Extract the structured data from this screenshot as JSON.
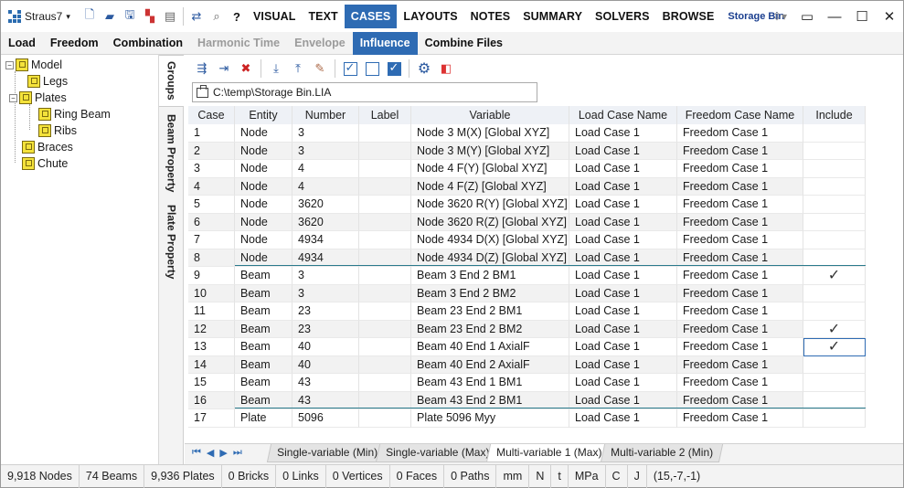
{
  "app": {
    "name": "Straus7"
  },
  "menu": {
    "items": [
      "VISUAL",
      "TEXT",
      "CASES",
      "LAYOUTS",
      "NOTES",
      "SUMMARY",
      "SOLVERS",
      "BROWSE"
    ],
    "active": "CASES",
    "model_name": "Storage Bin"
  },
  "subtabs": {
    "items": [
      {
        "label": "Load",
        "state": "normal"
      },
      {
        "label": "Freedom",
        "state": "normal"
      },
      {
        "label": "Combination",
        "state": "normal"
      },
      {
        "label": "Harmonic Time",
        "state": "disabled"
      },
      {
        "label": "Envelope",
        "state": "disabled"
      },
      {
        "label": "Influence",
        "state": "active"
      },
      {
        "label": "Combine Files",
        "state": "normal"
      }
    ]
  },
  "tree": {
    "root": "Model",
    "legs": "Legs",
    "plates": "Plates",
    "ring_beam": "Ring Beam",
    "ribs": "Ribs",
    "braces": "Braces",
    "chute": "Chute"
  },
  "side_tabs": [
    "Groups",
    "Beam Property",
    "Plate Property"
  ],
  "file_path": "C:\\temp\\Storage Bin.LIA",
  "table": {
    "headers": [
      "Case",
      "Entity",
      "Number",
      "Label",
      "Variable",
      "Load Case Name",
      "Freedom Case Name",
      "Include"
    ],
    "rows": [
      {
        "case": "1",
        "entity": "Node",
        "number": "3",
        "label": "",
        "variable": "Node 3 M(X) [Global XYZ]",
        "load": "Load Case 1",
        "freedom": "Freedom Case 1",
        "include": ""
      },
      {
        "case": "2",
        "entity": "Node",
        "number": "3",
        "label": "",
        "variable": "Node 3 M(Y) [Global XYZ]",
        "load": "Load Case 1",
        "freedom": "Freedom Case 1",
        "include": ""
      },
      {
        "case": "3",
        "entity": "Node",
        "number": "4",
        "label": "",
        "variable": "Node 4 F(Y) [Global XYZ]",
        "load": "Load Case 1",
        "freedom": "Freedom Case 1",
        "include": ""
      },
      {
        "case": "4",
        "entity": "Node",
        "number": "4",
        "label": "",
        "variable": "Node 4 F(Z) [Global XYZ]",
        "load": "Load Case 1",
        "freedom": "Freedom Case 1",
        "include": ""
      },
      {
        "case": "5",
        "entity": "Node",
        "number": "3620",
        "label": "",
        "variable": "Node 3620 R(Y) [Global XYZ]",
        "load": "Load Case 1",
        "freedom": "Freedom Case 1",
        "include": ""
      },
      {
        "case": "6",
        "entity": "Node",
        "number": "3620",
        "label": "",
        "variable": "Node 3620 R(Z) [Global XYZ]",
        "load": "Load Case 1",
        "freedom": "Freedom Case 1",
        "include": ""
      },
      {
        "case": "7",
        "entity": "Node",
        "number": "4934",
        "label": "",
        "variable": "Node 4934 D(X) [Global XYZ]",
        "load": "Load Case 1",
        "freedom": "Freedom Case 1",
        "include": ""
      },
      {
        "case": "8",
        "entity": "Node",
        "number": "4934",
        "label": "",
        "variable": "Node 4934 D(Z) [Global XYZ]",
        "load": "Load Case 1",
        "freedom": "Freedom Case 1",
        "include": ""
      },
      {
        "case": "9",
        "entity": "Beam",
        "number": "3",
        "label": "",
        "variable": "Beam 3 End 2 BM1",
        "load": "Load Case 1",
        "freedom": "Freedom Case 1",
        "include": "✓"
      },
      {
        "case": "10",
        "entity": "Beam",
        "number": "3",
        "label": "",
        "variable": "Beam 3 End 2 BM2",
        "load": "Load Case 1",
        "freedom": "Freedom Case 1",
        "include": ""
      },
      {
        "case": "11",
        "entity": "Beam",
        "number": "23",
        "label": "",
        "variable": "Beam 23 End 2 BM1",
        "load": "Load Case 1",
        "freedom": "Freedom Case 1",
        "include": ""
      },
      {
        "case": "12",
        "entity": "Beam",
        "number": "23",
        "label": "",
        "variable": "Beam 23 End 2 BM2",
        "load": "Load Case 1",
        "freedom": "Freedom Case 1",
        "include": "✓"
      },
      {
        "case": "13",
        "entity": "Beam",
        "number": "40",
        "label": "",
        "variable": "Beam 40 End 1 AxialF",
        "load": "Load Case 1",
        "freedom": "Freedom Case 1",
        "include": "✓"
      },
      {
        "case": "14",
        "entity": "Beam",
        "number": "40",
        "label": "",
        "variable": "Beam 40 End 2 AxialF",
        "load": "Load Case 1",
        "freedom": "Freedom Case 1",
        "include": ""
      },
      {
        "case": "15",
        "entity": "Beam",
        "number": "43",
        "label": "",
        "variable": "Beam 43 End 1 BM1",
        "load": "Load Case 1",
        "freedom": "Freedom Case 1",
        "include": ""
      },
      {
        "case": "16",
        "entity": "Beam",
        "number": "43",
        "label": "",
        "variable": "Beam 43 End 2 BM1",
        "load": "Load Case 1",
        "freedom": "Freedom Case 1",
        "include": ""
      },
      {
        "case": "17",
        "entity": "Plate",
        "number": "5096",
        "label": "",
        "variable": "Plate 5096 Myy",
        "load": "Load Case 1",
        "freedom": "Freedom Case 1",
        "include": ""
      }
    ]
  },
  "sheets": [
    "Single-variable (Min)",
    "Single-variable (Max)",
    "Multi-variable 1 (Max)",
    "Multi-variable 2 (Min)"
  ],
  "active_sheet": "Multi-variable 1 (Max)",
  "status": [
    "9,918 Nodes",
    "74 Beams",
    "9,936 Plates",
    "0 Bricks",
    "0 Links",
    "0 Vertices",
    "0 Faces",
    "0 Paths",
    "mm",
    "N",
    "t",
    "MPa",
    "C",
    "J",
    "(15,-7,-1)"
  ],
  "colors": {
    "accent": "#2e6bb3",
    "group_divider": "#2a7a8c"
  }
}
